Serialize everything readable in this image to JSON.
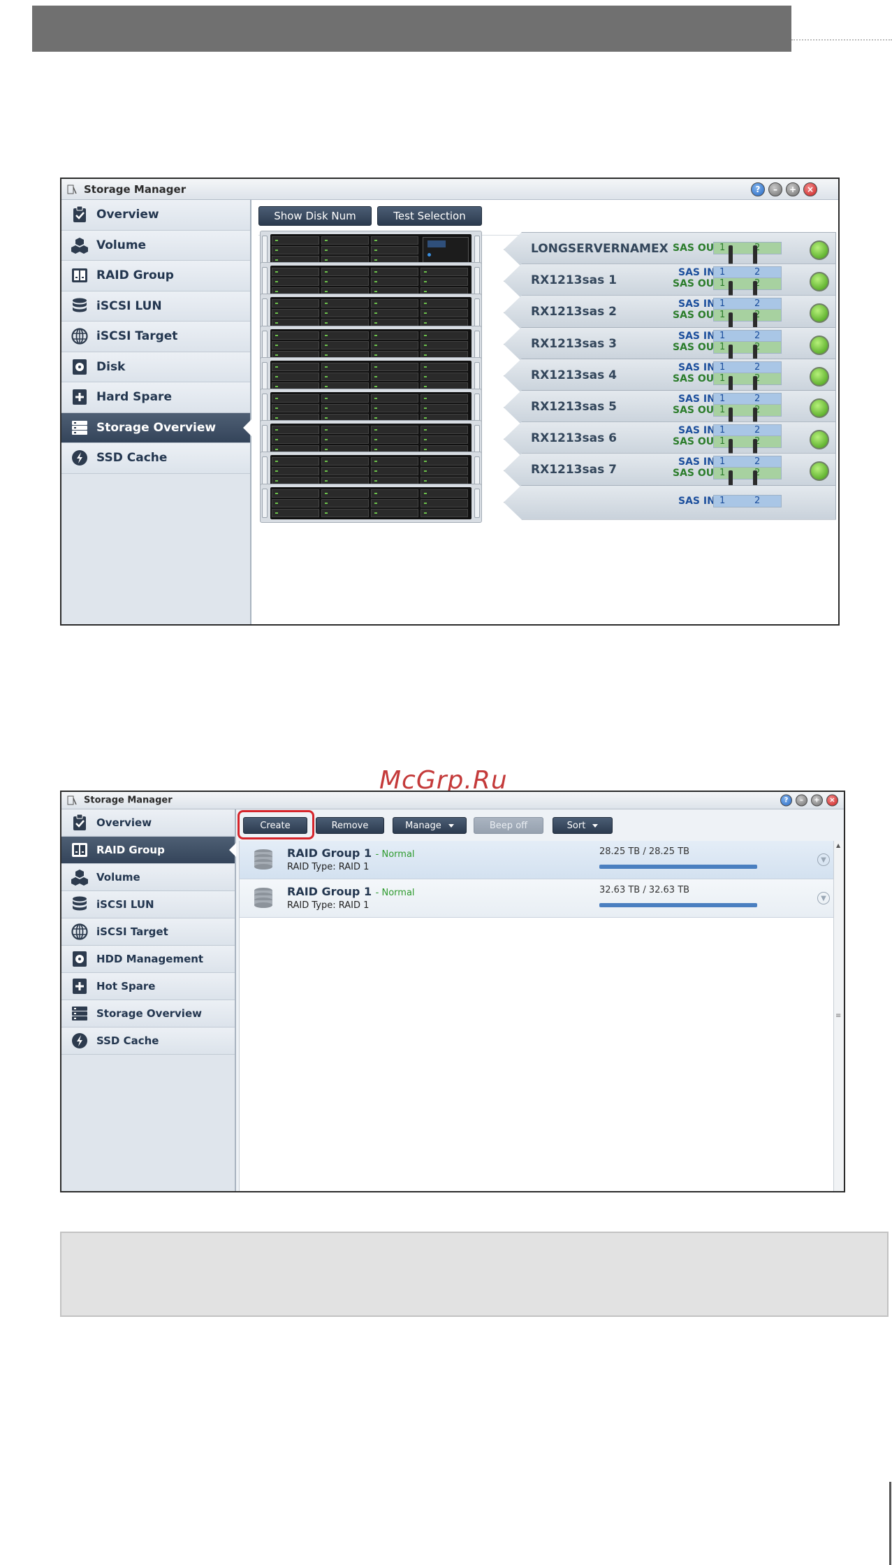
{
  "window1": {
    "title": "Storage Manager",
    "sidebar": [
      {
        "label": "Overview",
        "icon": "clipboard-check-icon",
        "active": false
      },
      {
        "label": "Volume",
        "icon": "cubes-icon",
        "active": false
      },
      {
        "label": "RAID Group",
        "icon": "raid-group-icon",
        "active": false
      },
      {
        "label": "iSCSI LUN",
        "icon": "database-icon",
        "active": false
      },
      {
        "label": "iSCSI Target",
        "icon": "globe-icon",
        "active": false
      },
      {
        "label": "Disk",
        "icon": "disk-icon",
        "active": false
      },
      {
        "label": "Hard Spare",
        "icon": "plus-box-icon",
        "active": false
      },
      {
        "label": "Storage Overview",
        "icon": "server-stack-icon",
        "active": true
      },
      {
        "label": "SSD Cache",
        "icon": "lightning-icon",
        "active": false
      }
    ],
    "toolbar": {
      "show_disk_num": "Show Disk Num",
      "test_selection": "Test Selection"
    },
    "units": [
      {
        "name": "LONGSERVERNAMEX",
        "sas_in": "",
        "sas_out": "SAS OUT"
      },
      {
        "name": "RX1213sas 1",
        "sas_in": "SAS IN",
        "sas_out": "SAS OUT"
      },
      {
        "name": "RX1213sas 2",
        "sas_in": "SAS IN",
        "sas_out": "SAS OUT"
      },
      {
        "name": "RX1213sas 3",
        "sas_in": "SAS IN",
        "sas_out": "SAS OUT"
      },
      {
        "name": "RX1213sas 4",
        "sas_in": "SAS IN",
        "sas_out": "SAS OUT"
      },
      {
        "name": "RX1213sas 5",
        "sas_in": "SAS IN",
        "sas_out": "SAS OUT"
      },
      {
        "name": "RX1213sas 6",
        "sas_in": "SAS IN",
        "sas_out": "SAS OUT"
      },
      {
        "name": "RX1213sas 7",
        "sas_in": "SAS IN",
        "sas_out": "SAS OUT"
      },
      {
        "name": "",
        "sas_in": "SAS IN",
        "sas_out": ""
      }
    ],
    "port_labels": [
      "1",
      "2"
    ]
  },
  "watermark": "McGrp.Ru",
  "window2": {
    "title": "Storage Manager",
    "sidebar": [
      {
        "label": "Overview",
        "icon": "clipboard-check-icon",
        "active": false
      },
      {
        "label": "RAID Group",
        "icon": "raid-group-icon",
        "active": true
      },
      {
        "label": "Volume",
        "icon": "cubes-icon",
        "active": false
      },
      {
        "label": "iSCSI LUN",
        "icon": "database-icon",
        "active": false
      },
      {
        "label": "iSCSI Target",
        "icon": "globe-icon",
        "active": false
      },
      {
        "label": "HDD Management",
        "icon": "disk-icon",
        "active": false
      },
      {
        "label": "Hot Spare",
        "icon": "plus-box-icon",
        "active": false
      },
      {
        "label": "Storage Overview",
        "icon": "server-stack-icon",
        "active": false
      },
      {
        "label": "SSD Cache",
        "icon": "lightning-icon",
        "active": false
      }
    ],
    "toolbar": {
      "create": "Create",
      "remove": "Remove",
      "manage": "Manage",
      "beep_off": "Beep off",
      "sort": "Sort"
    },
    "raid_groups": [
      {
        "name": "RAID Group 1",
        "status": "- Normal",
        "type": "RAID Type: RAID 1",
        "capacity": "28.25 TB / 28.25 TB",
        "used_fraction": 1.0
      },
      {
        "name": "RAID Group 1",
        "status": "- Normal",
        "type": "RAID Type: RAID 1",
        "capacity": "32.63 TB / 32.63 TB",
        "used_fraction": 1.0
      }
    ]
  },
  "colors": {
    "accent_active": "#3b4b60",
    "highlight_red": "#d6242a",
    "status_green": "#2d9a2d"
  }
}
